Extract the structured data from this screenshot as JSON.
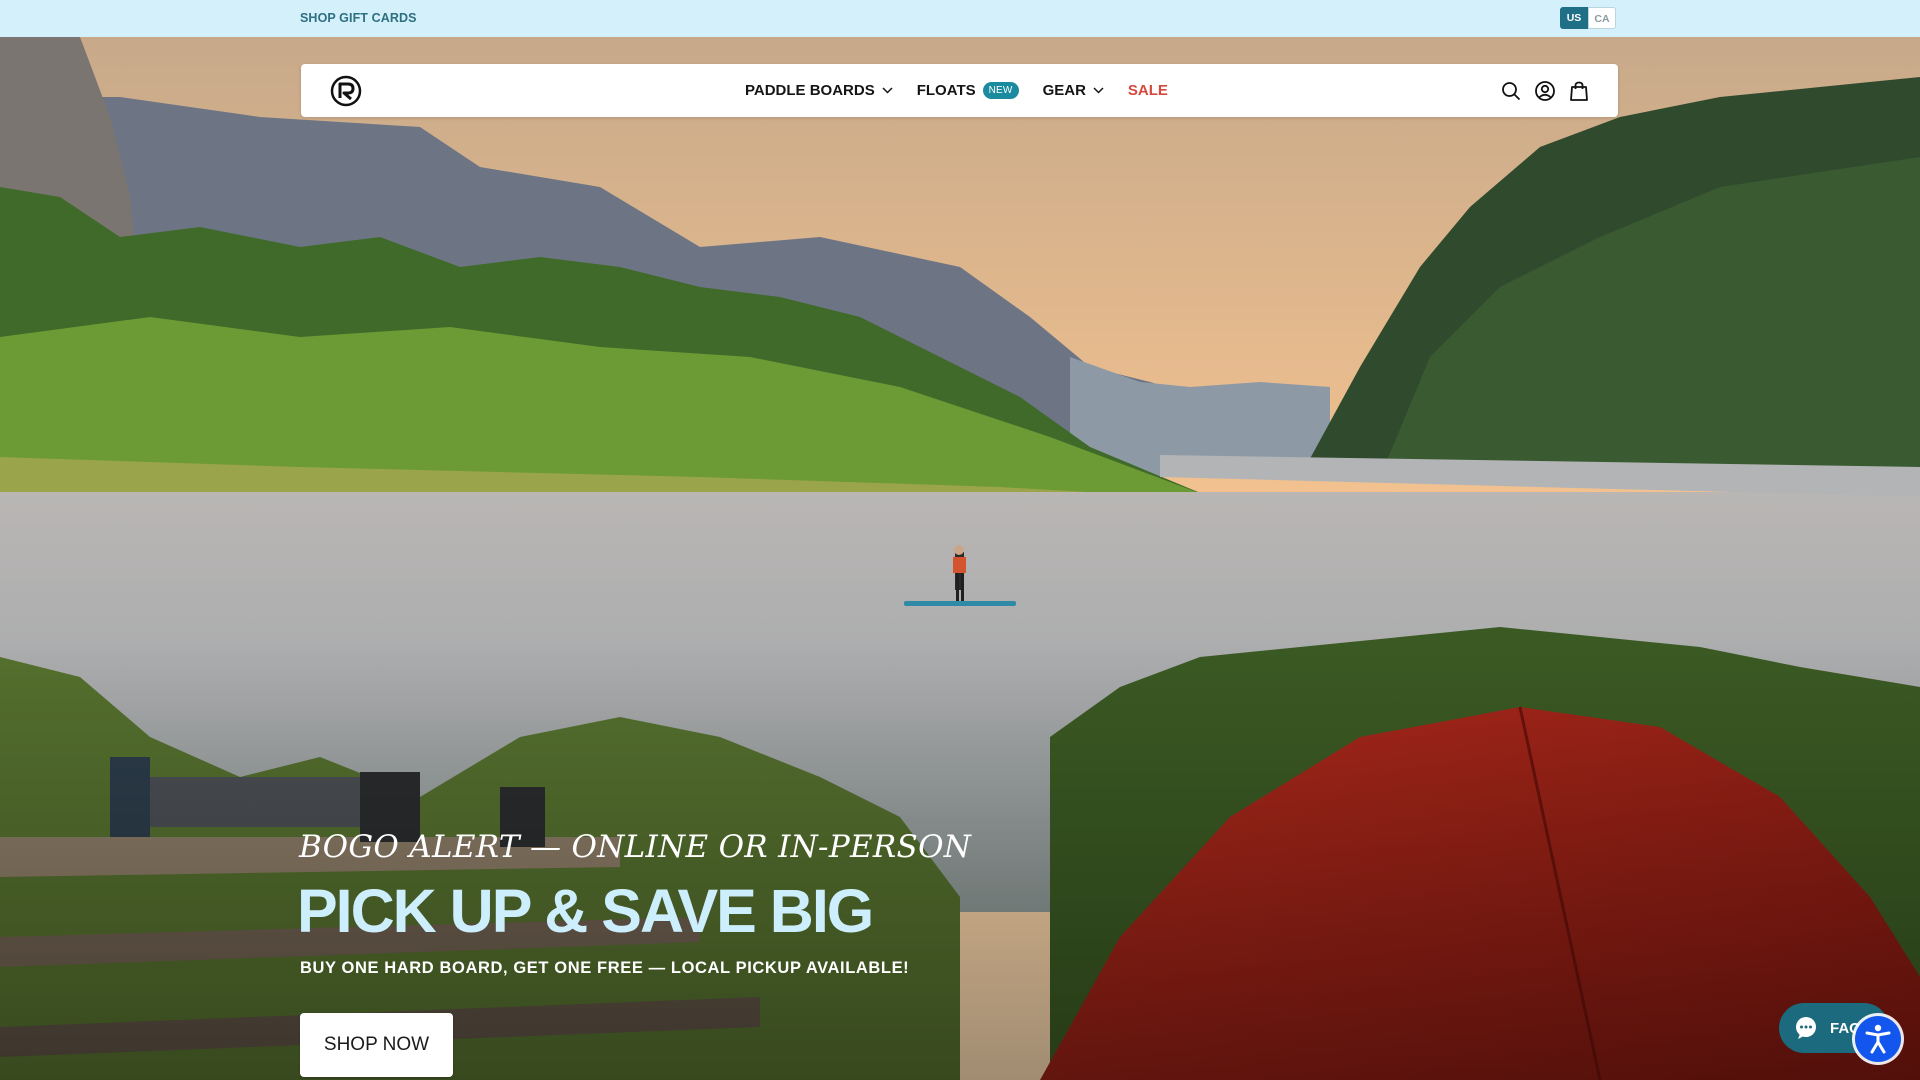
{
  "topbar": {
    "gift_cards": "SHOP GIFT CARDS",
    "regions": [
      "US",
      "CA"
    ],
    "selected_region": "US"
  },
  "header": {
    "nav": [
      {
        "label": "PADDLE BOARDS",
        "has_dropdown": true
      },
      {
        "label": "FLOATS",
        "badge": "NEW"
      },
      {
        "label": "GEAR",
        "has_dropdown": true
      },
      {
        "label": "SALE",
        "color": "#d4483e"
      }
    ],
    "icons": [
      "search-icon",
      "account-icon",
      "cart-icon"
    ]
  },
  "hero": {
    "eyebrow": "BOGO ALERT — ONLINE OR IN-PERSON",
    "headline": "PICK UP & SAVE BIG",
    "subline": "BUY ONE HARD BOARD, GET ONE FREE — LOCAL PICKUP AVAILABLE!",
    "cta": "SHOP NOW"
  },
  "widgets": {
    "faq_label": "FAQ",
    "accessibility": "accessibility-icon"
  },
  "colors": {
    "topbar_bg": "#d3f0fb",
    "accent": "#1a8a9e",
    "sale": "#d4483e",
    "headline": "#cdeefc"
  }
}
